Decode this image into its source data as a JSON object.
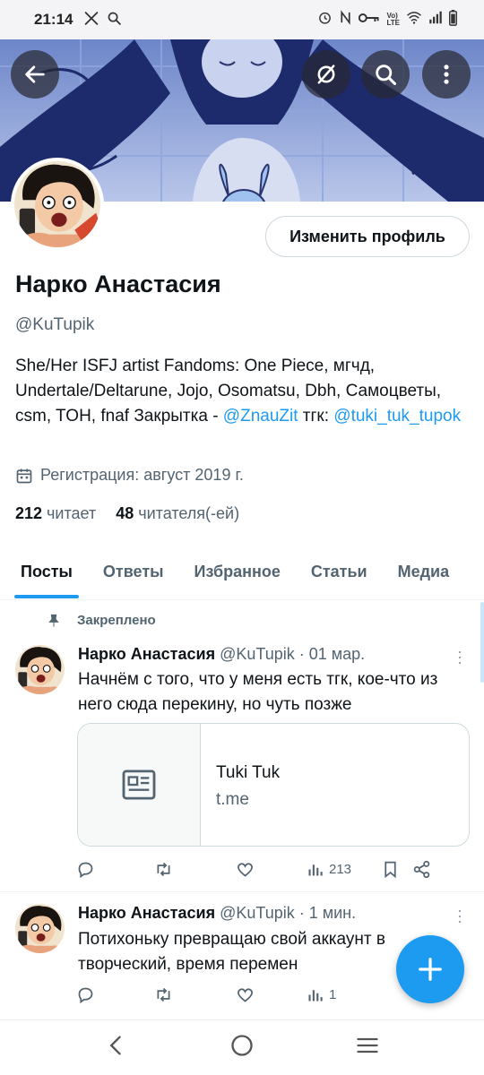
{
  "status_bar": {
    "time": "21:14",
    "left_icons": [
      "x-logo-icon",
      "search-icon"
    ],
    "right_icons": [
      "alarm-icon",
      "nfc-icon",
      "key-icon",
      "volte-icon",
      "wifi-icon",
      "signal-icon",
      "battery-icon"
    ]
  },
  "header": {
    "back_icon": "arrow-left-icon",
    "buttons": [
      "hide-icon",
      "search-icon",
      "more-vertical-icon"
    ]
  },
  "profile": {
    "edit_button": "Изменить профиль",
    "name": "Нарко Анастасия",
    "handle": "@KuTupik",
    "bio_text_1": "She/Her ISFJ artist Fandoms: One Piece, мгчд, Undertale/Deltarune, Jojo, Osomatsu, Dbh, Самоцветы, csm, TOH, fnaf Закрытка - ",
    "bio_link_1": "@ZnauZit",
    "bio_text_2": " тгк: ",
    "bio_link_2": "@tuki_tuk_tupok",
    "joined": "Регистрация: август 2019 г.",
    "following_count": "212",
    "following_label": "читает",
    "followers_count": "48",
    "followers_label": "читателя(-ей)"
  },
  "tabs": [
    "Посты",
    "Ответы",
    "Избранное",
    "Статьи",
    "Медиа"
  ],
  "active_tab": "Посты",
  "pinned_label": "Закреплено",
  "tweets": [
    {
      "name": "Нарко Анастасия",
      "handle": "@KuTupik",
      "time": "· 01 мар.",
      "text": "Начнём с того, что у меня есть тгк, кое-что из него сюда перекину, но чуть позже",
      "card": {
        "title": "Tuki Tuk",
        "domain": "t.me"
      },
      "views": "213"
    },
    {
      "name": "Нарко Анастасия",
      "handle": "@KuTupik",
      "time": "· 1 мин.",
      "text": "Потихоньку превращаю свой аккаунт в творческий, время перемен",
      "views": "1"
    }
  ],
  "accent_color": "#1d9bf0"
}
